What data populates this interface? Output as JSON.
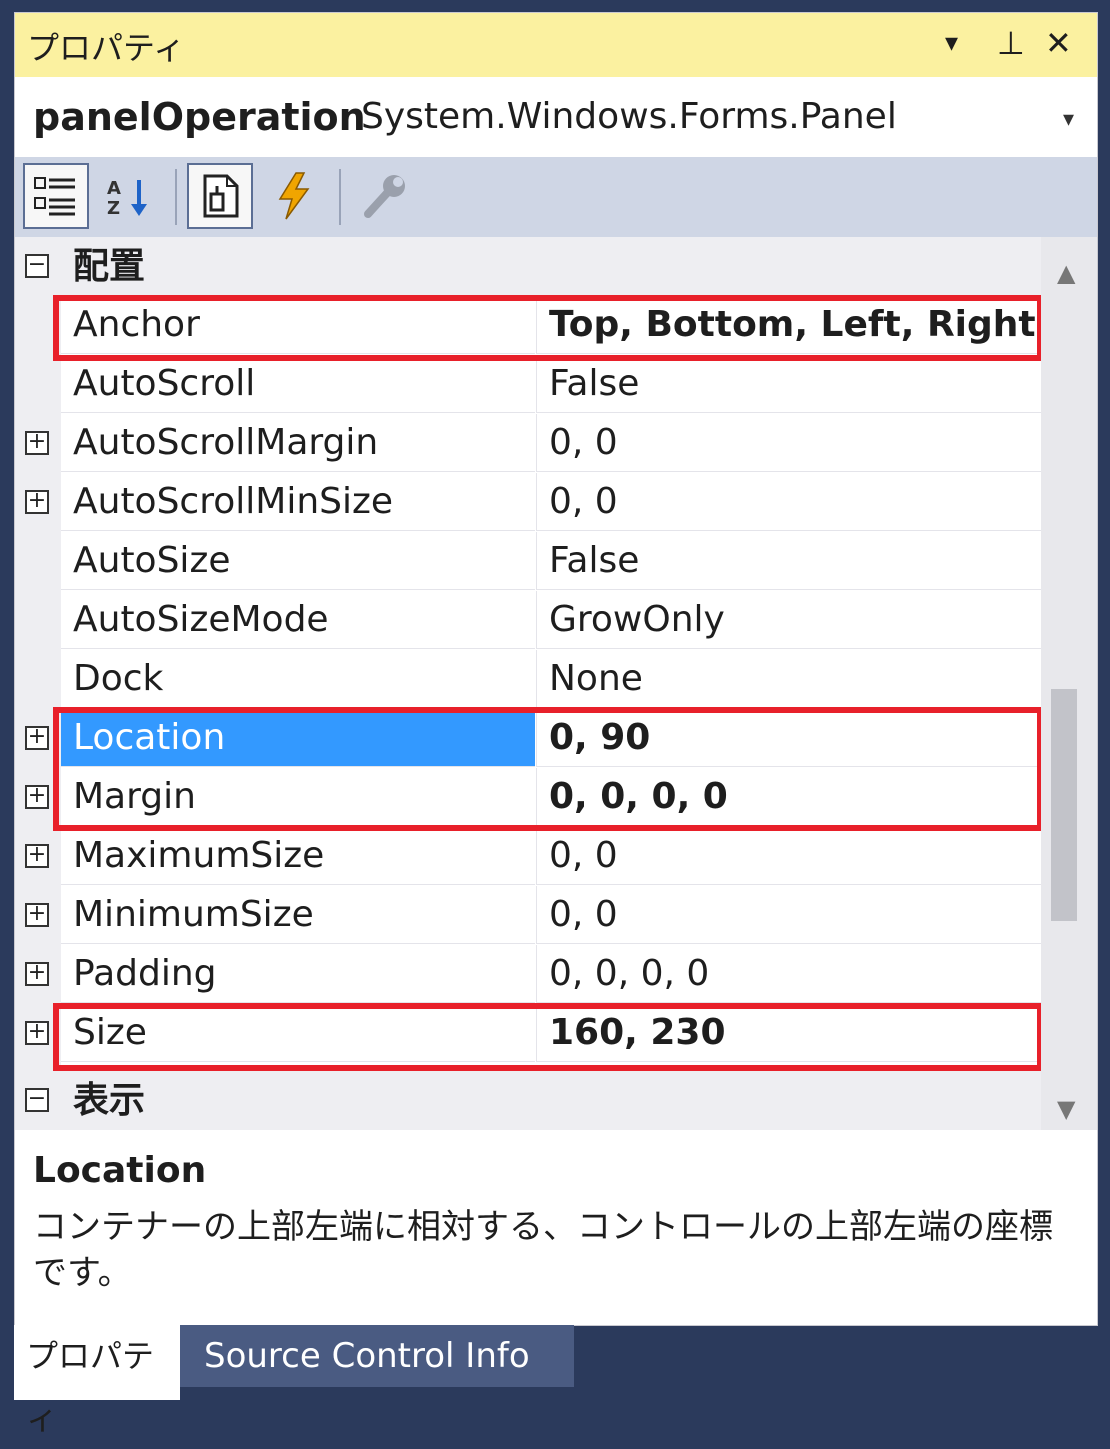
{
  "window": {
    "title": "プロパティ"
  },
  "title_buttons": {
    "dropdown": "▾",
    "pin": "⊥",
    "close": "✕"
  },
  "object_selector": {
    "name": "panelOperation",
    "type": "System.Windows.Forms.Panel",
    "dropdown": "▾"
  },
  "toolbar": {
    "buttons": [
      {
        "icon": "categorized-icon",
        "selected": true
      },
      {
        "icon": "alphabetical-icon",
        "selected": false
      },
      {
        "icon": "properties-icon",
        "selected": true
      },
      {
        "icon": "events-icon",
        "selected": false
      },
      {
        "icon": "property-pages-icon",
        "selected": false
      }
    ]
  },
  "categories": [
    {
      "name": "配置",
      "expander": "⊟"
    },
    {
      "name": "表示",
      "expander": "⊟"
    }
  ],
  "expander_plus": "+",
  "expander_minus": "−",
  "properties": [
    {
      "name": "Anchor",
      "value": "Top, Bottom, Left, Right",
      "bold": true,
      "expandable": false
    },
    {
      "name": "AutoScroll",
      "value": "False",
      "bold": false,
      "expandable": false
    },
    {
      "name": "AutoScrollMargin",
      "value": "0, 0",
      "bold": false,
      "expandable": true
    },
    {
      "name": "AutoScrollMinSize",
      "value": "0, 0",
      "bold": false,
      "expandable": true
    },
    {
      "name": "AutoSize",
      "value": "False",
      "bold": false,
      "expandable": false
    },
    {
      "name": "AutoSizeMode",
      "value": "GrowOnly",
      "bold": false,
      "expandable": false
    },
    {
      "name": "Dock",
      "value": "None",
      "bold": false,
      "expandable": false
    },
    {
      "name": "Location",
      "value": "0, 90",
      "bold": true,
      "expandable": true,
      "selected": true
    },
    {
      "name": "Margin",
      "value": "0, 0, 0, 0",
      "bold": true,
      "expandable": true
    },
    {
      "name": "MaximumSize",
      "value": "0, 0",
      "bold": false,
      "expandable": true
    },
    {
      "name": "MinimumSize",
      "value": "0, 0",
      "bold": false,
      "expandable": true
    },
    {
      "name": "Padding",
      "value": "0, 0, 0, 0",
      "bold": false,
      "expandable": true
    },
    {
      "name": "Size",
      "value": "160, 230",
      "bold": true,
      "expandable": true
    }
  ],
  "scrollbar": {
    "up": "▲",
    "down": "▼"
  },
  "description": {
    "title": "Location",
    "text": "コンテナーの上部左端に相対する、コントロールの上部左端の座標です。"
  },
  "tabs": [
    {
      "label": "プロパティ",
      "active": true
    },
    {
      "label": "Source Control Info",
      "active": false
    }
  ],
  "colors": {
    "highlight": "#e8202a",
    "selection": "#3399ff",
    "title_bar": "#fbf1a0",
    "tab_bar": "#2b3a5c"
  }
}
